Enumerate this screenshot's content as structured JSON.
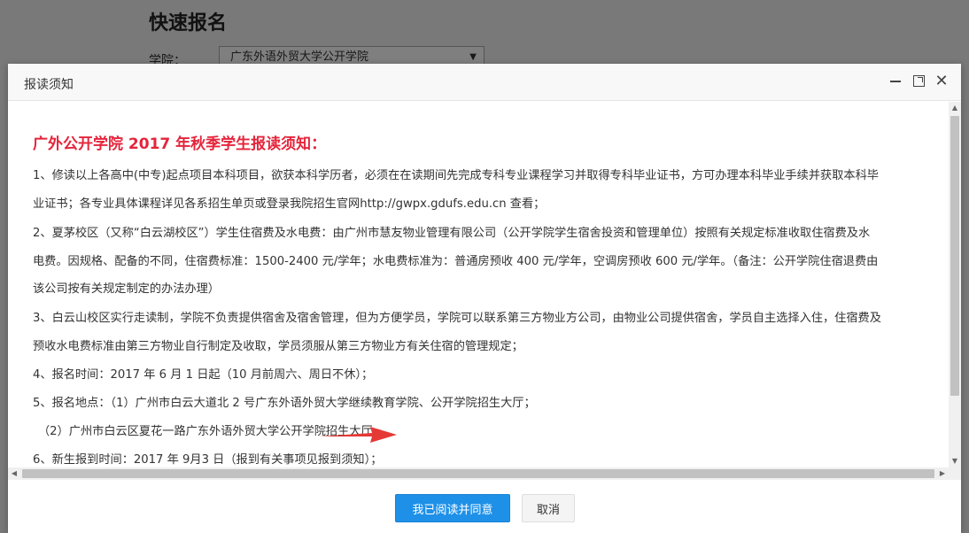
{
  "background": {
    "title": "快速报名",
    "college_label": "学院：",
    "college_value": "广东外语外贸大学公开学院"
  },
  "modal": {
    "title": "报读须知",
    "notice_title": "广外公开学院 2017 年秋季学生报读须知：",
    "lines": [
      "1、修读以上各高中(中专)起点项目本科项目，欲获本科学历者，必须在在读期间先完成专科专业课程学习并取得专科毕业证书，方可办理本科毕业手续并获取本科毕",
      "业证书；各专业具体课程详见各系招生单页或登录我院招生官网http://gwpx.gdufs.edu.cn 查看；",
      "2、夏茅校区（又称“白云湖校区”）学生住宿费及水电费：由广州市慧友物业管理有限公司（公开学院学生宿舍投资和管理单位）按照有关规定标准收取住宿费及水",
      "电费。因规格、配备的不同，住宿费标准：1500-2400 元/学年；水电费标准为：普通房预收 400 元/学年，空调房预收 600 元/学年。（备注：公开学院住宿退费由",
      "该公司按有关规定制定的办法办理）",
      "3、白云山校区实行走读制，学院不负责提供宿舍及宿舍管理，但为方便学员，学院可以联系第三方物业方公司，由物业公司提供宿舍，学员自主选择入住，住宿费及",
      "预收水电费标准由第三方物业自行制定及收取，学员须服从第三方物业方有关住宿的管理规定；",
      "4、报名时间：2017 年 6 月 1 日起（10 月前周六、周日不休）；",
      "5、报名地点：（1）广州市白云大道北 2 号广东外语外贸大学继续教育学院、公开学院招生大厅；",
      "（2）广州市白云区夏花一路广东外语外贸大学公开学院招生大厅",
      "6、新生报到时间：2017 年 9月3 日（报到有关事项见报到须知）；"
    ],
    "agree_label": "我已阅读并同意",
    "cancel_label": "取消"
  },
  "colors": {
    "notice_title": "#e5243b",
    "primary_button": "#1e90e8",
    "annotation_arrow": "#e53935"
  },
  "icons": {
    "minimize": "minimize-icon",
    "maximize": "maximize-icon",
    "close": "close-icon",
    "select_arrow": "chevron-down-icon",
    "annotation": "red-arrow-icon"
  }
}
